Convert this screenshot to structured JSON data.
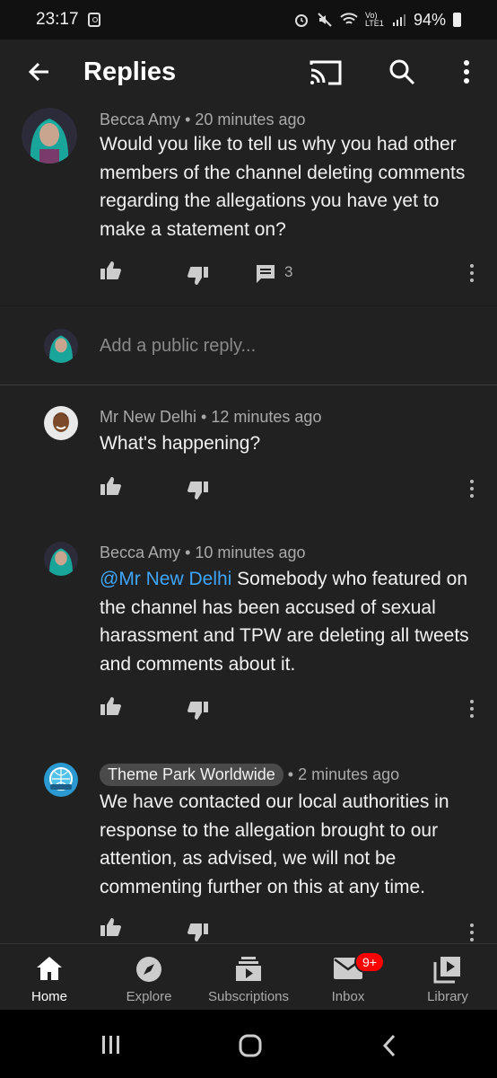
{
  "status_bar": {
    "time": "23:17",
    "network": "Vo) LTE1",
    "battery": "94%"
  },
  "app_bar": {
    "title": "Replies"
  },
  "parent_comment": {
    "author": "Becca Amy",
    "time": "20 minutes ago",
    "text": "Would you like to tell us why you had other members of the channel deleting comments regarding the allegations you have yet to make a statement on?",
    "reply_count": "3"
  },
  "reply_input": {
    "placeholder": "Add a public reply..."
  },
  "replies": [
    {
      "author": "Mr New Delhi",
      "time": "12 minutes ago",
      "text": "What's happening?"
    },
    {
      "author": "Becca Amy",
      "time": "10 minutes ago",
      "mention": "@Mr New Delhi",
      "text": " Somebody who featured on the channel has been accused of sexual harassment and TPW are deleting all tweets and comments about it."
    },
    {
      "author": "Theme Park Worldwide",
      "time": "2 minutes ago",
      "text": "We have contacted our local authorities in response to the allegation brought to our attention, as advised, we will not be commenting further on this at any time."
    }
  ],
  "meta_separator": "•",
  "bottom_nav": {
    "items": [
      {
        "label": "Home",
        "icon": "home-icon"
      },
      {
        "label": "Explore",
        "icon": "compass-icon"
      },
      {
        "label": "Subscriptions",
        "icon": "subscriptions-icon"
      },
      {
        "label": "Inbox",
        "icon": "mail-icon",
        "badge": "9+"
      },
      {
        "label": "Library",
        "icon": "library-icon"
      }
    ]
  },
  "colors": {
    "background": "#212121",
    "accent_link": "#3ea6ff",
    "badge": "#ff0000"
  }
}
